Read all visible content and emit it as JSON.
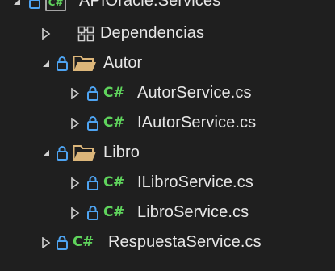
{
  "colors": {
    "background": "#1f1f1f",
    "text": "#e6e6e6",
    "lock": "#4ea4f2",
    "csharp": "#5fd35c",
    "folder": "#dcb67a",
    "chevron": "#d0d0d0"
  },
  "tree": {
    "project": {
      "label": "APIOracle.Services",
      "icon": "csharp-project-icon",
      "expanded": true
    },
    "dependencies": {
      "label": "Dependencias",
      "icon": "dependencies-icon",
      "expanded": false
    },
    "folders": [
      {
        "label": "Autor",
        "icon": "folder-open-icon",
        "expanded": true,
        "files": [
          {
            "label": "AutorService.cs",
            "icon": "csharp-file-icon",
            "glyph": "C#"
          },
          {
            "label": "IAutorService.cs",
            "icon": "csharp-file-icon",
            "glyph": "C#"
          }
        ]
      },
      {
        "label": "Libro",
        "icon": "folder-open-icon",
        "expanded": true,
        "files": [
          {
            "label": "ILibroService.cs",
            "icon": "csharp-file-icon",
            "glyph": "C#"
          },
          {
            "label": "LibroService.cs",
            "icon": "csharp-file-icon",
            "glyph": "C#"
          }
        ]
      }
    ],
    "root_files": [
      {
        "label": "RespuestaService.cs",
        "icon": "csharp-file-icon",
        "glyph": "C#"
      }
    ],
    "csproj_glyph": "C#"
  }
}
